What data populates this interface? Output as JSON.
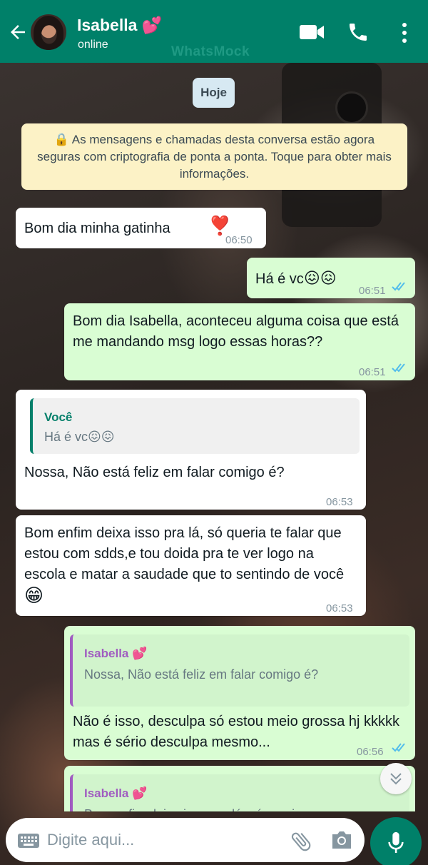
{
  "header": {
    "contact_name": "Isabella 💕",
    "status": "online",
    "watermark": "WhatsMock",
    "icons": [
      "back-arrow-icon",
      "video-call-icon",
      "phone-call-icon",
      "more-vert-icon"
    ]
  },
  "chat": {
    "date_label": "Hoje",
    "encryption_notice": "🔒 As mensagens e chamadas desta conversa estão agora seguras com criptografia de ponta a ponta. Toque para obter mais informações.",
    "messages": [
      {
        "direction": "in",
        "text": "Bom dia minha gatinha",
        "emoji": "❣️",
        "time": "06:50"
      },
      {
        "direction": "out",
        "text": "Há é vc",
        "emoji": "😖😖",
        "time": "06:51",
        "status": "read"
      },
      {
        "direction": "out",
        "text": "Bom dia Isabella, aconteceu alguma coisa que está me mandando msg logo essas horas??",
        "time": "06:51",
        "status": "read"
      },
      {
        "direction": "in",
        "quote_author": "Você",
        "quote_text": "Há é vc😖😖",
        "text": "Nossa, Não está feliz em falar comigo é?",
        "time": "06:53"
      },
      {
        "direction": "in",
        "text": "Bom enfim deixa isso pra lá, só queria te falar que estou com sdds,e tou doida pra te ver logo na escola e matar a saudade que to sentindo de você",
        "emoji": "😁",
        "time": "06:53"
      },
      {
        "direction": "out",
        "quote_author": "Isabella 💕",
        "quote_text": "Nossa, Não está feliz em falar comigo é?",
        "text": "Não é isso, desculpa só estou meio grossa hj kkkkk mas é sério desculpa mesmo...",
        "time": "06:56",
        "status": "read"
      },
      {
        "direction": "out",
        "quote_author": "Isabella 💕",
        "quote_text": "Bom enfim deixa isso pra lá, só queria",
        "text": "",
        "time": "",
        "status": "read"
      }
    ]
  },
  "composer": {
    "placeholder": "Digite aqui...",
    "icons": [
      "keyboard-icon",
      "attach-icon",
      "camera-icon",
      "mic-icon"
    ]
  },
  "colors": {
    "header": "#008069",
    "incoming_bubble": "#ffffff",
    "outgoing_bubble": "#d9fdd3",
    "read_ticks": "#53bdeb",
    "quote_green": "#06806b",
    "quote_purple": "#a05cc0"
  }
}
